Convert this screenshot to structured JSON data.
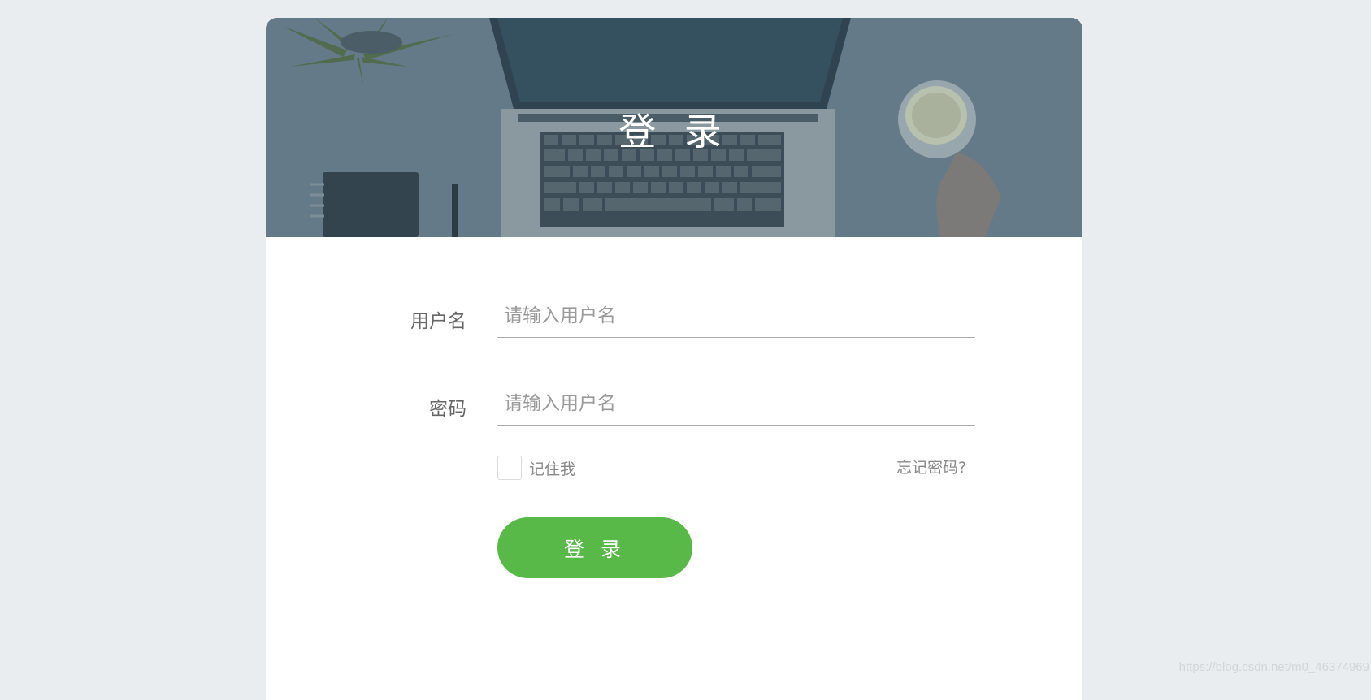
{
  "banner": {
    "title": "登 录"
  },
  "form": {
    "username": {
      "label": "用户名",
      "placeholder": "请输入用户名",
      "value": ""
    },
    "password": {
      "label": "密码",
      "placeholder": "请输入用户名",
      "value": ""
    },
    "remember_label": "记住我",
    "remember_checked": false,
    "forgot_link": "忘记密码?",
    "submit_label": "登 录"
  },
  "watermark": "https://blog.csdn.net/m0_46374969",
  "colors": {
    "background": "#e9edef",
    "card": "#ffffff",
    "banner_overlay": "#647886",
    "accent_button": "#58b948",
    "label_text": "#666666",
    "placeholder_text": "#9a9a9a"
  },
  "icons": {
    "checkbox": "empty-checkbox"
  }
}
